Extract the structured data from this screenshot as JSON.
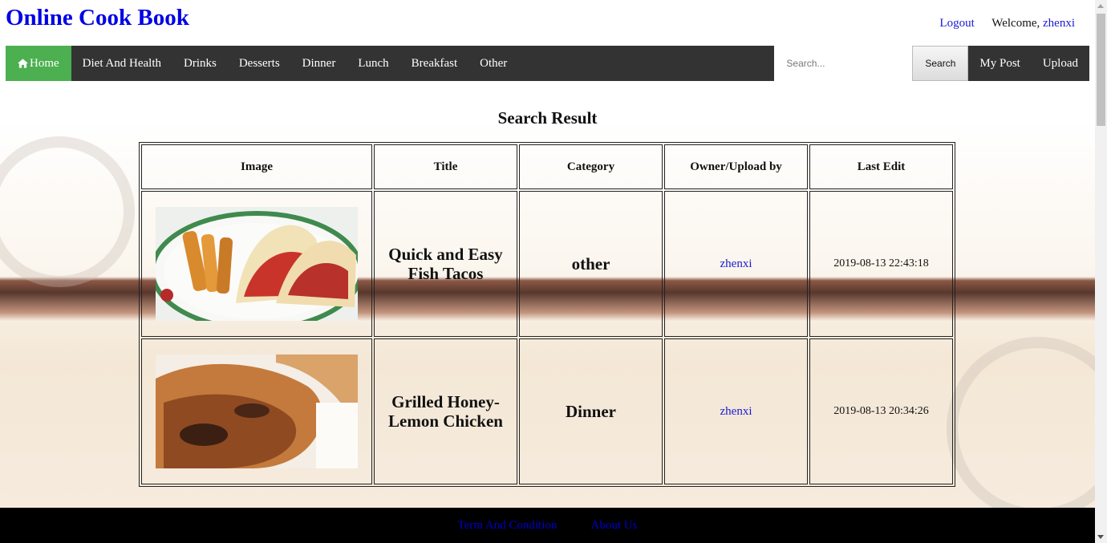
{
  "site": {
    "title": "Online Cook Book"
  },
  "user": {
    "logout_label": "Logout",
    "welcome_label": "Welcome,",
    "username": "zhenxi"
  },
  "nav": {
    "items": [
      {
        "label": "Home",
        "active": true
      },
      {
        "label": "Diet And Health"
      },
      {
        "label": "Drinks"
      },
      {
        "label": "Desserts"
      },
      {
        "label": "Dinner"
      },
      {
        "label": "Lunch"
      },
      {
        "label": "Breakfast"
      },
      {
        "label": "Other"
      }
    ],
    "search_placeholder": "Search...",
    "search_button": "Search",
    "my_post": "My Post",
    "upload": "Upload",
    "active_color": "#4caf50",
    "bar_color": "#333333"
  },
  "results": {
    "heading": "Search Result",
    "columns": [
      "Image",
      "Title",
      "Category",
      "Owner/Upload by",
      "Last Edit"
    ],
    "rows": [
      {
        "image_icon": "fish-tacos-photo",
        "title": "Quick and Easy Fish Tacos",
        "category": "other",
        "owner": "zhenxi",
        "last_edit": "2019-08-13 22:43:18"
      },
      {
        "image_icon": "grilled-chicken-photo",
        "title": "Grilled Honey-Lemon Chicken",
        "category": "Dinner",
        "owner": "zhenxi",
        "last_edit": "2019-08-13 20:34:26"
      }
    ]
  },
  "footer": {
    "terms": "Term And Condition",
    "about": "About Us"
  }
}
